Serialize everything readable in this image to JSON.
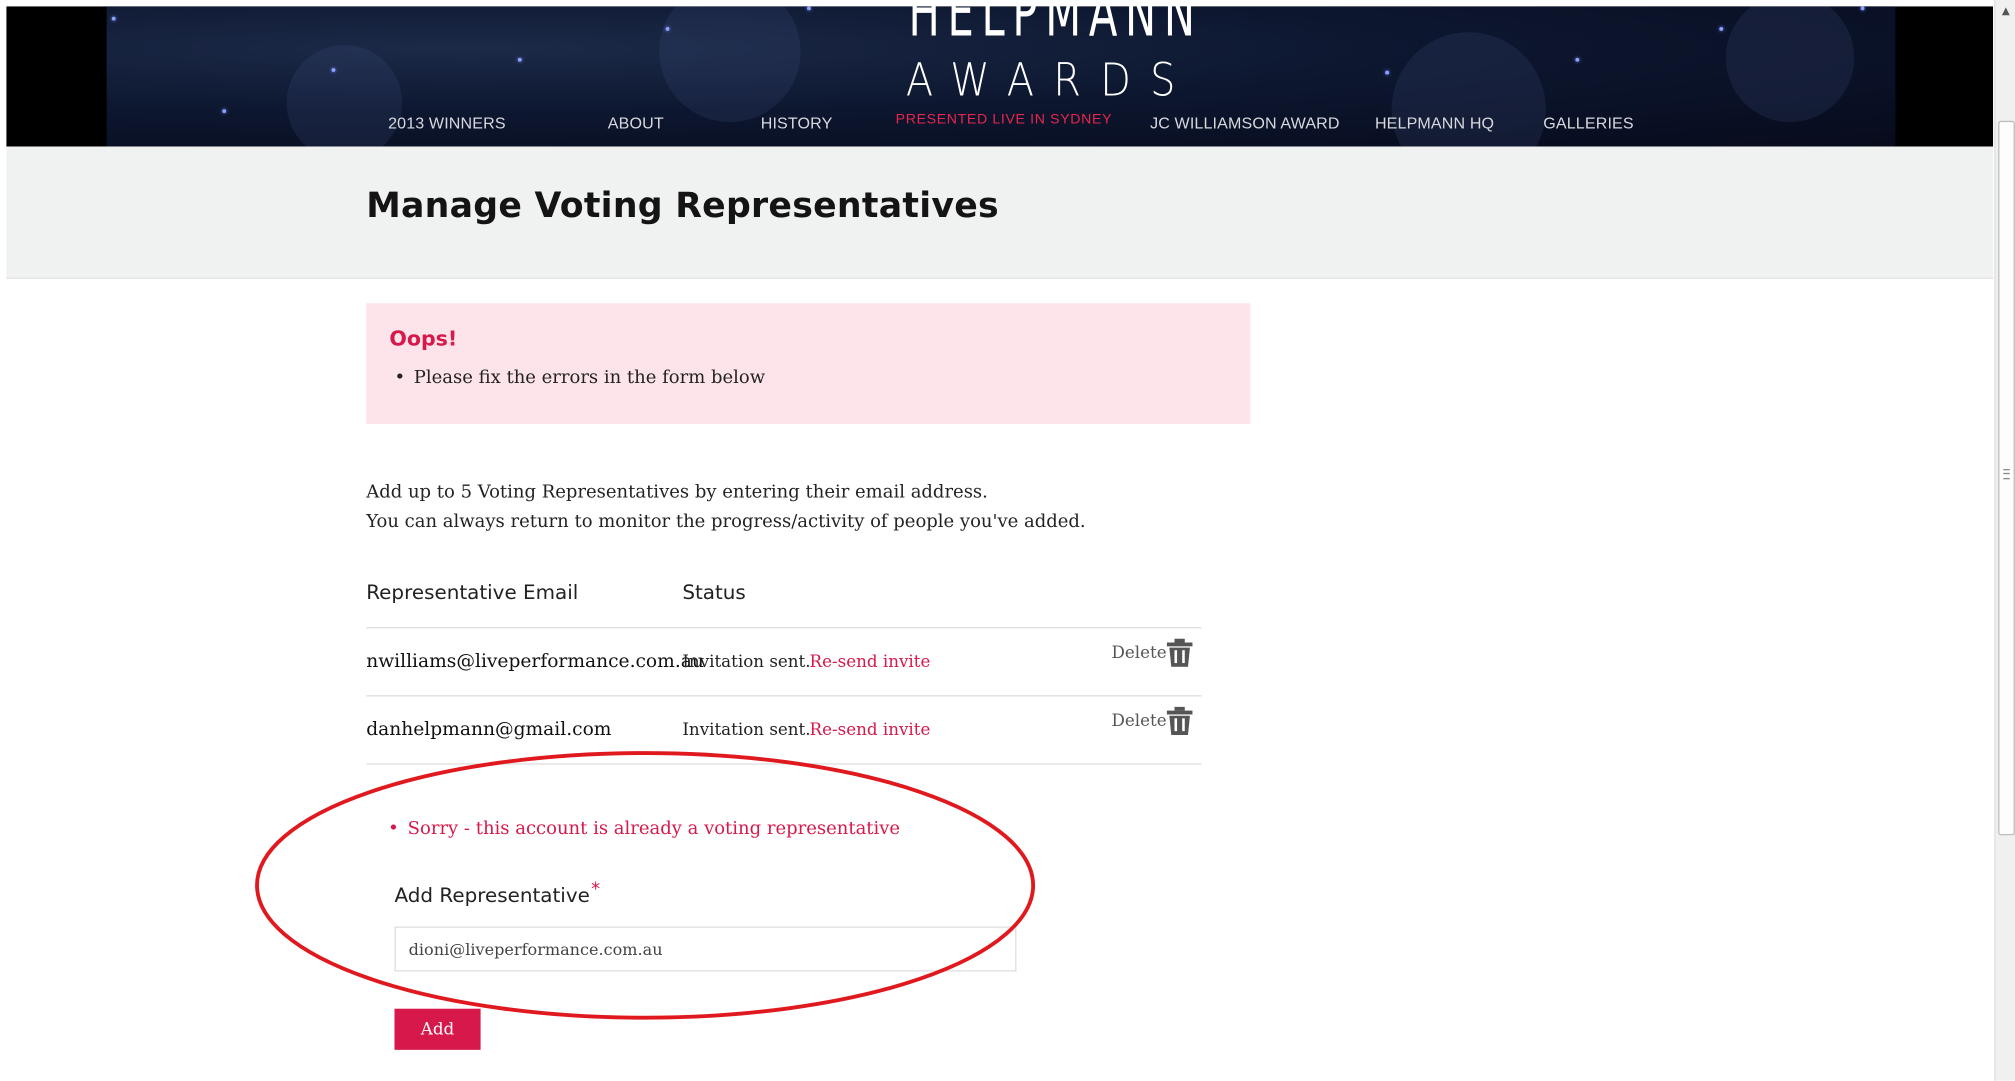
{
  "logo": {
    "top_text": "HELPMANN",
    "awards_text": "AWARDS",
    "tagline": "PRESENTED LIVE IN SYDNEY"
  },
  "nav": {
    "winners": "2013 WINNERS",
    "about": "ABOUT",
    "history": "HISTORY",
    "jcw": "JC WILLIAMSON AWARD",
    "hq": "HELPMANN HQ",
    "galleries": "GALLERIES"
  },
  "page": {
    "title": "Manage Voting Representatives"
  },
  "alert": {
    "title": "Oops!",
    "message": "Please fix the errors in the form below"
  },
  "intro": {
    "line1": "Add up to 5 Voting Representatives by entering their email address.",
    "line2": "You can always return to monitor the progress/activity of people you've added."
  },
  "table": {
    "headers": {
      "email": "Representative Email",
      "status": "Status"
    },
    "rows": [
      {
        "email": "nwilliams@liveperformance.com.au",
        "status": "Invitation sent.",
        "resend": "Re-send invite",
        "delete": "Delete"
      },
      {
        "email": "danhelpmann@gmail.com",
        "status": "Invitation sent.",
        "resend": "Re-send invite",
        "delete": "Delete"
      }
    ]
  },
  "form": {
    "error": "Sorry - this account is already a voting representative",
    "label": "Add Representative",
    "required_mark": "*",
    "value": "dioni@liveperformance.com.au",
    "button": "Add"
  },
  "colors": {
    "accent": "#d6184a",
    "alert_bg": "#fde3ea",
    "header_bg": "#0d1730",
    "annotation": "#e0191f"
  },
  "icons": {
    "trash": "trash-icon",
    "scroll_up": "scroll-up-arrow-icon"
  }
}
